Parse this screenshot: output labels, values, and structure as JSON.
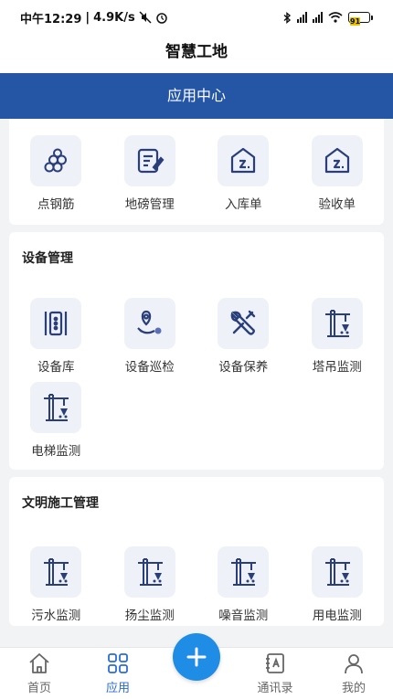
{
  "status_bar": {
    "time": "中午12:29",
    "net_speed": "4.9K/s",
    "battery": "91"
  },
  "app_title": "智慧工地",
  "banner_title": "应用中心",
  "quick_apps": [
    {
      "label": "点钢筋",
      "icon": "rebar-icon"
    },
    {
      "label": "地磅管理",
      "icon": "weighbridge-icon"
    },
    {
      "label": "入库单",
      "icon": "warehouse-in-icon"
    },
    {
      "label": "验收单",
      "icon": "acceptance-icon"
    }
  ],
  "equipment": {
    "title": "设备管理",
    "items": [
      {
        "label": "设备库",
        "icon": "equipment-library-icon"
      },
      {
        "label": "设备巡检",
        "icon": "inspection-route-icon"
      },
      {
        "label": "设备保养",
        "icon": "maintenance-tools-icon"
      },
      {
        "label": "塔吊监测",
        "icon": "tower-crane-icon"
      },
      {
        "label": "电梯监测",
        "icon": "tower-crane-icon"
      }
    ]
  },
  "civilized": {
    "title": "文明施工管理",
    "items": [
      {
        "label": "污水监测",
        "icon": "tower-crane-icon"
      },
      {
        "label": "扬尘监测",
        "icon": "tower-crane-icon"
      },
      {
        "label": "噪音监测",
        "icon": "tower-crane-icon"
      },
      {
        "label": "用电监测",
        "icon": "tower-crane-icon"
      }
    ]
  },
  "tabbar": {
    "home": "首页",
    "apps": "应用",
    "contacts": "通讯录",
    "mine": "我的",
    "active": "apps"
  },
  "colors": {
    "banner": "#2556a6",
    "accent": "#2b6bd6",
    "fab": "#1f8de6",
    "icon_stroke": "#2a3f7a"
  }
}
